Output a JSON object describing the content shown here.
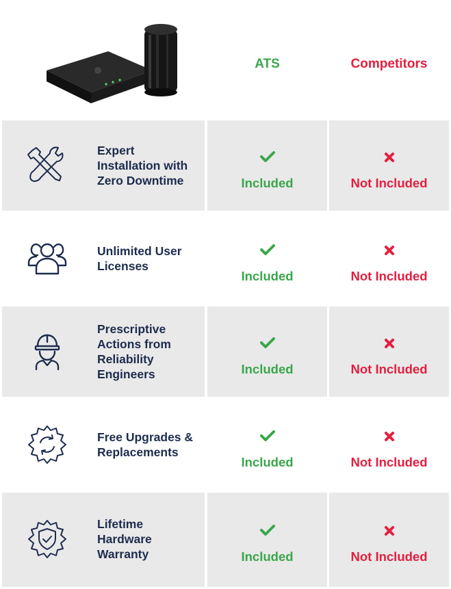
{
  "header": {
    "product_image": "sensor-and-gateway-devices",
    "col_ats": "ATS",
    "col_competitors": "Competitors"
  },
  "colors": {
    "navy": "#1d2c4d",
    "green": "#3aa64a",
    "red": "#e41e3f",
    "gray_cell": "#e9e9e9"
  },
  "rows": [
    {
      "icon": "tools-icon",
      "label": "Expert Installation with Zero Downtime",
      "ats": "Included",
      "competitors": "Not Included"
    },
    {
      "icon": "users-icon",
      "label": "Unlimited User Licenses",
      "ats": "Included",
      "competitors": "Not Included"
    },
    {
      "icon": "engineer-icon",
      "label": "Prescriptive Actions from Reliability Engineers",
      "ats": "Included",
      "competitors": "Not Included"
    },
    {
      "icon": "refresh-gear-icon",
      "label": "Free Upgrades & Replacements",
      "ats": "Included",
      "competitors": "Not Included"
    },
    {
      "icon": "shield-check-icon",
      "label": "Lifetime Hardware Warranty",
      "ats": "Included",
      "competitors": "Not Included"
    }
  ]
}
